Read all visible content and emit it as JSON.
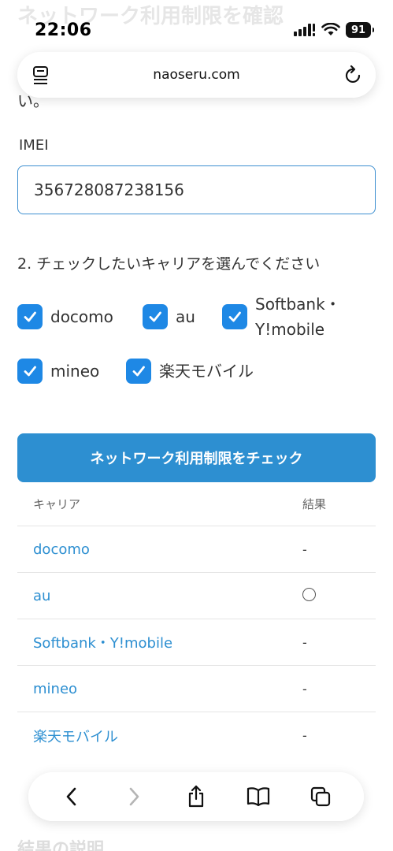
{
  "page": {
    "ghost_title": "ネットワーク利用制限を確認",
    "ghost_subtitle": "い。",
    "ghost_bottom": "結果の説明"
  },
  "status_bar": {
    "time": "22:06",
    "battery": "91"
  },
  "browser": {
    "url": "naoseru.com",
    "reader_icon": "reader-icon",
    "reload_icon": "reload-icon"
  },
  "form": {
    "imei_label": "IMEI",
    "imei_value": "356728087238156",
    "step_heading": "2. チェックしたいキャリアを選んでください",
    "carriers": [
      {
        "label": "docomo",
        "checked": true
      },
      {
        "label": "au",
        "checked": true
      },
      {
        "label_line1": "Softbank・",
        "label_line2": "Y!mobile",
        "checked": true
      },
      {
        "label": "mineo",
        "checked": true
      },
      {
        "label": "楽天モバイル",
        "checked": true
      }
    ],
    "check_button": "ネットワーク利用制限をチェック"
  },
  "results": {
    "headers": [
      "キャリア",
      "結果"
    ],
    "rows": [
      {
        "carrier": "docomo",
        "result": "-"
      },
      {
        "carrier": "au",
        "result": "○"
      },
      {
        "carrier": "Softbank・Y!mobile",
        "result": "-"
      },
      {
        "carrier": "mineo",
        "result": "-"
      },
      {
        "carrier": "楽天モバイル",
        "result": "-"
      }
    ]
  },
  "toolbar": {
    "icons": [
      "back-icon",
      "forward-icon",
      "share-icon",
      "bookmarks-icon",
      "tabs-icon"
    ]
  },
  "colors": {
    "accent": "#2d8fd1",
    "checkbox": "#1e88e5"
  }
}
